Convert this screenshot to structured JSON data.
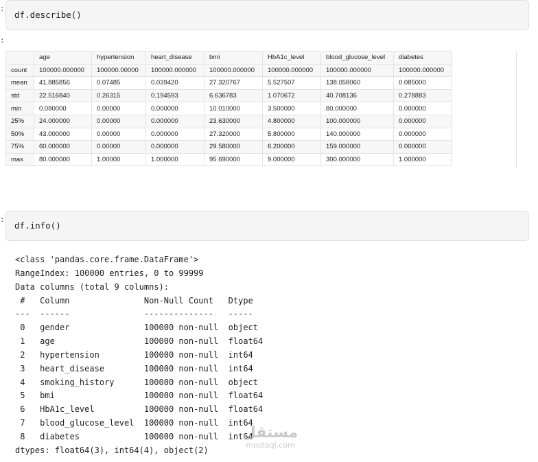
{
  "prompt_marker": ":",
  "cells": {
    "describe_code": "df.describe()",
    "info_code": "df.info()"
  },
  "describe_table": {
    "columns": [
      "age",
      "hypertension",
      "heart_disease",
      "bmi",
      "HbA1c_level",
      "blood_glucose_level",
      "diabetes"
    ],
    "rows": [
      {
        "label": "count",
        "values": [
          "100000.000000",
          "100000.00000",
          "100000.000000",
          "100000.000000",
          "100000.000000",
          "100000.000000",
          "100000.000000"
        ]
      },
      {
        "label": "mean",
        "values": [
          "41.885856",
          "0.07485",
          "0.039420",
          "27.320767",
          "5.527507",
          "138.058060",
          "0.085000"
        ]
      },
      {
        "label": "std",
        "values": [
          "22.516840",
          "0.26315",
          "0.194593",
          "6.636783",
          "1.070672",
          "40.708136",
          "0.278883"
        ]
      },
      {
        "label": "min",
        "values": [
          "0.080000",
          "0.00000",
          "0.000000",
          "10.010000",
          "3.500000",
          "80.000000",
          "0.000000"
        ]
      },
      {
        "label": "25%",
        "values": [
          "24.000000",
          "0.00000",
          "0.000000",
          "23.630000",
          "4.800000",
          "100.000000",
          "0.000000"
        ]
      },
      {
        "label": "50%",
        "values": [
          "43.000000",
          "0.00000",
          "0.000000",
          "27.320000",
          "5.800000",
          "140.000000",
          "0.000000"
        ]
      },
      {
        "label": "75%",
        "values": [
          "60.000000",
          "0.00000",
          "0.000000",
          "29.580000",
          "6.200000",
          "159.000000",
          "0.000000"
        ]
      },
      {
        "label": "max",
        "values": [
          "80.000000",
          "1.00000",
          "1.000000",
          "95.690000",
          "9.000000",
          "300.000000",
          "1.000000"
        ]
      }
    ]
  },
  "info_output": {
    "lines": [
      "<class 'pandas.core.frame.DataFrame'>",
      "RangeIndex: 100000 entries, 0 to 99999",
      "Data columns (total 9 columns):",
      " #   Column               Non-Null Count   Dtype",
      "---  ------               --------------   -----",
      " 0   gender               100000 non-null  object",
      " 1   age                  100000 non-null  float64",
      " 2   hypertension         100000 non-null  int64",
      " 3   heart_disease        100000 non-null  int64",
      " 4   smoking_history      100000 non-null  object",
      " 5   bmi                  100000 non-null  float64",
      " 6   HbA1c_level          100000 non-null  float64",
      " 7   blood_glucose_level  100000 non-null  int64",
      " 8   diabetes             100000 non-null  int64",
      "dtypes: float64(3), int64(4), object(2)"
    ]
  },
  "watermark": {
    "arabic": "مستقل",
    "latin": "mostaql.com"
  }
}
